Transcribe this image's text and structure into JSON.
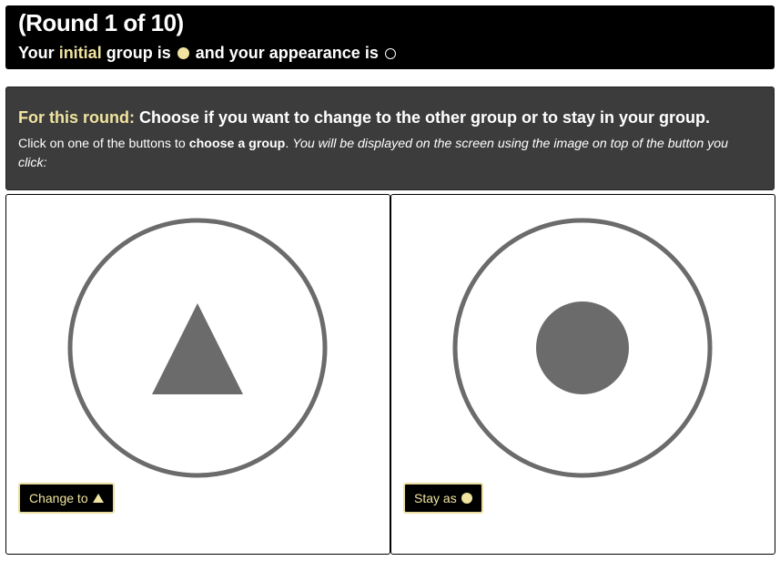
{
  "header": {
    "round_title": "(Round 1 of 10)",
    "status_prefix": "Your",
    "status_highlight": "initial",
    "status_group": "group is",
    "status_appearance": "and your appearance is",
    "group_icon": "filled-circle",
    "appearance_icon": "hollow-circle"
  },
  "instructions": {
    "lead": "For this round:",
    "title": "Choose if you want to change to the other group or to stay in your group.",
    "body_start": "Click on one of the buttons to",
    "body_bold": "choose a group",
    "body_period": ".",
    "body_italic": "You will be displayed on the screen using the image on top of the button you click:"
  },
  "options": {
    "change": {
      "image_icon": "triangle-icon",
      "button_label": "Change to",
      "button_icon": "triangle"
    },
    "stay": {
      "image_icon": "filled-circle-icon",
      "button_label": "Stay as",
      "button_icon": "filled-circle"
    }
  },
  "colors": {
    "accent": "#f0e4a0",
    "header_bg": "#000000",
    "instructions_bg": "#3c3c3c",
    "shape_gray": "#6b6b6b"
  }
}
